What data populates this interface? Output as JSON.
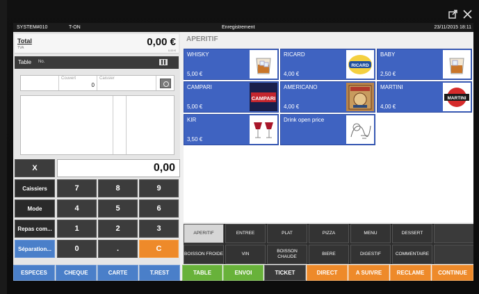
{
  "window": {
    "icons": [
      "external-link-icon",
      "close-icon"
    ]
  },
  "statusbar": {
    "system": "SYSTEM#010",
    "user": "T-ON",
    "title": "Enregistrement",
    "datetime": "23/11/2015 18:11"
  },
  "total": {
    "label": "Total",
    "value": "0,00 €",
    "tva_label": "TVA",
    "tva_value": "0,00 €"
  },
  "table": {
    "label": "Table",
    "no_label": "No."
  },
  "info": {
    "couvert_label": "Couvert",
    "couvert_value": "0",
    "caissier_label": "Caissier"
  },
  "keypad": {
    "display": "0,00",
    "x": "X",
    "side": [
      "Caissiers",
      "Mode",
      "Repas com...",
      "Séparation..."
    ],
    "keys": [
      "7",
      "8",
      "9",
      "4",
      "5",
      "6",
      "1",
      "2",
      "3",
      "0",
      ".",
      "C"
    ]
  },
  "category": {
    "title": "APERITIF"
  },
  "products": [
    {
      "name": "WHISKY",
      "price": "5,00 €",
      "icon": "whisky-glass-icon"
    },
    {
      "name": "RICARD",
      "price": "4,00 €",
      "icon": "ricard-logo-icon"
    },
    {
      "name": "BABY",
      "price": "2,50 €",
      "icon": "whisky-glass-icon"
    },
    {
      "name": "CAMPARI",
      "price": "5,00 €",
      "icon": "campari-logo-icon"
    },
    {
      "name": "AMERICANO",
      "price": "4,00 €",
      "icon": "americano-poster-icon"
    },
    {
      "name": "MARTINI",
      "price": "4,00 €",
      "icon": "martini-logo-icon"
    },
    {
      "name": "KIR",
      "price": "3,50 €",
      "icon": "wine-glasses-icon"
    },
    {
      "name": "Drink open price",
      "price": "",
      "icon": "sketch-drawing-icon"
    }
  ],
  "logos": {
    "ricard": "RICARD",
    "campari": "CAMPARI",
    "martini": "MARTINI"
  },
  "tabs_row1": [
    "APERITIF",
    "ENTREE",
    "PLAT",
    "PIZZA",
    "MENU",
    "DESSERT",
    ""
  ],
  "tabs_row2": [
    "BOISSON FROIDE",
    "VIN",
    "BOISSON CHAUDE",
    "BIERE",
    "DIGESTIF",
    "COMMENTAIRE",
    ""
  ],
  "actions": [
    "ESPECES",
    "CHEQUE",
    "CARTE",
    "T.REST",
    "TABLE",
    "ENVOI",
    "TICKET",
    "DIRECT",
    "A SUIVRE",
    "RECLAME",
    "CONTINUE"
  ],
  "colors": {
    "blue": "#4a7fc9",
    "product_blue": "#3f63c1",
    "green": "#68b23a",
    "orange": "#ee8a2a",
    "dark": "#3a3a3a"
  }
}
